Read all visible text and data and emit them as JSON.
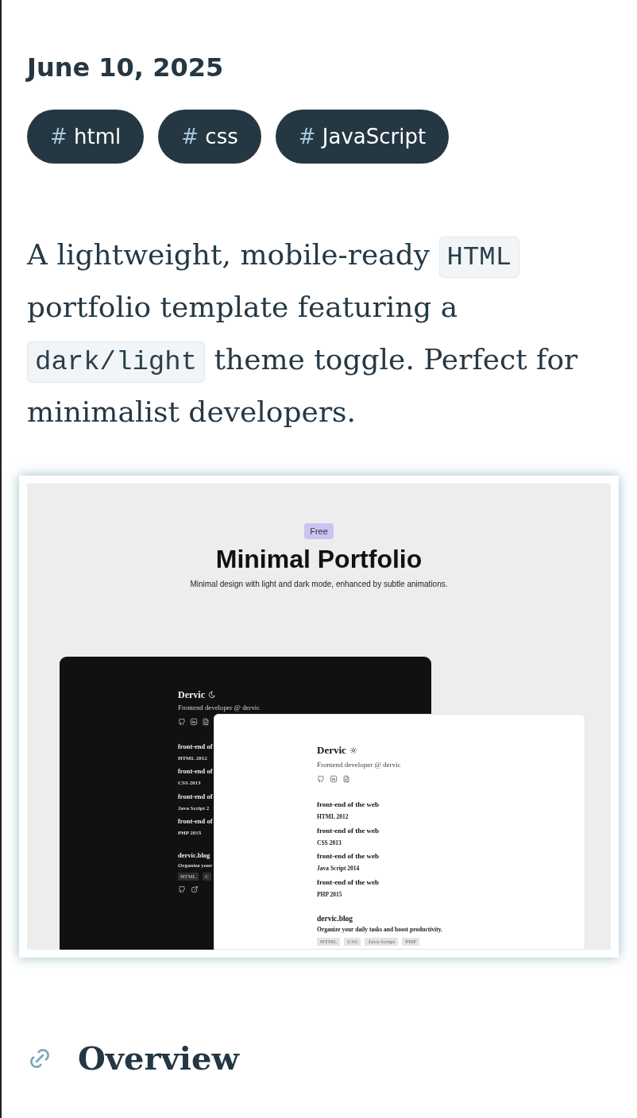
{
  "post": {
    "date": "June 10, 2025",
    "tags": [
      {
        "prefix": "#",
        "label": "html"
      },
      {
        "prefix": "#",
        "label": "css"
      },
      {
        "prefix": "#",
        "label": "JavaScript"
      }
    ]
  },
  "summary": [
    {
      "kind": "text",
      "text": "A lightweight, mobile-ready "
    },
    {
      "kind": "code",
      "text": "HTML"
    },
    {
      "kind": "text",
      "text": " portfolio template featuring a "
    },
    {
      "kind": "code",
      "text": "dark/light"
    },
    {
      "kind": "text",
      "text": " theme toggle. Perfect for minimalist developers."
    }
  ],
  "preview": {
    "badge": "Free",
    "title": "Minimal Portfolio",
    "subtitle": "Minimal design with light and dark mode, enhanced by subtle animations.",
    "cards": [
      {
        "dark_mode": true,
        "name": "Dervic",
        "role": "Frontend developer @ dervic",
        "experience": [
          {
            "title": "front-end of",
            "detail": "HTML 2012"
          },
          {
            "title": "front-end of",
            "detail": "CSS 2013"
          },
          {
            "title": "front-end of",
            "detail": "Java Script 2"
          },
          {
            "title": "front-end of",
            "detail": "PHP 2015"
          }
        ],
        "project": {
          "title": "dervic.blog",
          "description": "Organize your",
          "tags": [
            "HTML",
            "C"
          ],
          "link_icons": true
        }
      },
      {
        "dark_mode": false,
        "name": "Dervic",
        "role": "Frontend developer @ dervic",
        "experience": [
          {
            "title": "front-end of the web",
            "detail": "HTML 2012"
          },
          {
            "title": "front-end of the web",
            "detail": "CSS 2013"
          },
          {
            "title": "front-end of the web",
            "detail": "Java Script 2014"
          },
          {
            "title": "front-end of the web",
            "detail": "PHP 2015"
          }
        ],
        "project": {
          "title": "dervic.blog",
          "description": "Organize your daily tasks and boost productivity.",
          "tags": [
            "HTML",
            "CSS",
            "Java Script",
            "PHP"
          ],
          "link_icons": false
        }
      }
    ]
  },
  "section": {
    "heading": "Overview"
  }
}
